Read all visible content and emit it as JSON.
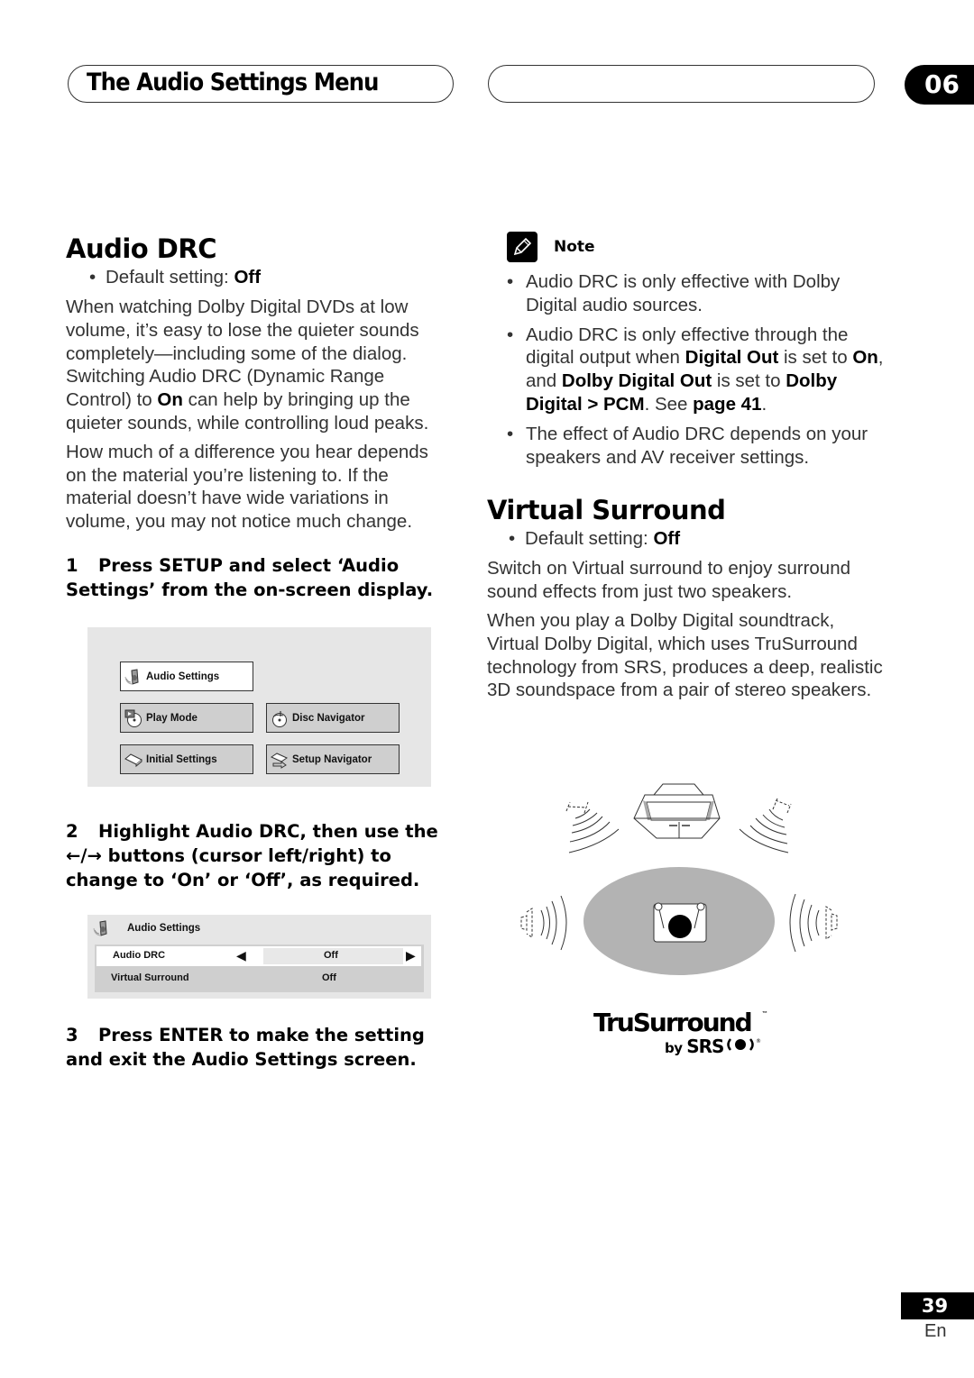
{
  "header": {
    "section_title": "The Audio Settings Menu",
    "middle_pill_text": "",
    "chapter_number": "06"
  },
  "audio_drc": {
    "heading": "Audio DRC",
    "default_label": "Default setting: ",
    "default_value": "Off",
    "para1": {
      "before": "When watching Dolby Digital DVDs at low volume, it’s easy to lose the quieter sounds completely—including some of the dialog. Switching Audio DRC (Dynamic Range Control) to ",
      "bold": "On",
      "after": " can help by bringing up the quieter sounds, while controlling loud peaks."
    },
    "para2": "How much of a difference you hear depends on the material you’re listening to. If the material doesn’t have wide variations in volume, you may not notice much change.",
    "steps": [
      {
        "num": "1",
        "text": "Press SETUP and select ‘Audio Settings’ from the on-screen display."
      },
      {
        "num": "2",
        "arrows": "←/→",
        "text": " buttons (cursor left/right) to change to ‘On’ or ‘Off’, as required.",
        "lead": "Highlight Audio DRC, then use the"
      },
      {
        "num": "3",
        "text": "Press ENTER to make the setting and exit the Audio Settings screen."
      }
    ]
  },
  "setup_menu": {
    "items": [
      {
        "label": "Audio Settings",
        "icon": "speaker-icon",
        "active": true
      },
      {
        "label": "Play Mode",
        "icon": "disc-play-icon",
        "active": false
      },
      {
        "label": "Disc Navigator",
        "icon": "disc-navigator-icon",
        "active": false
      },
      {
        "label": "Initial Settings",
        "icon": "settings-tray-icon",
        "active": false
      },
      {
        "label": "Setup Navigator",
        "icon": "navigator-arrow-icon",
        "active": false
      }
    ]
  },
  "audio_settings_screen": {
    "title": "Audio Settings",
    "rows": [
      {
        "label": "Audio DRC",
        "value": "Off",
        "selected": true,
        "left_arrow": "◀",
        "right_arrow": "▶"
      },
      {
        "label": "Virtual Surround",
        "value": "Off",
        "selected": false
      }
    ]
  },
  "note": {
    "title": "Note",
    "items": [
      {
        "segments": [
          {
            "t": "Audio DRC is only effective with Dolby Digital audio sources.",
            "b": false
          }
        ]
      },
      {
        "segments": [
          {
            "t": "Audio DRC is only effective through the digital output when ",
            "b": false
          },
          {
            "t": "Digital Out",
            "b": true
          },
          {
            "t": " is set to ",
            "b": false
          },
          {
            "t": "On",
            "b": true
          },
          {
            "t": ", and ",
            "b": false
          },
          {
            "t": "Dolby Digital Out",
            "b": true
          },
          {
            "t": " is set to ",
            "b": false
          },
          {
            "t": "Dolby Digital > PCM",
            "b": true
          },
          {
            "t": ". See ",
            "b": false
          },
          {
            "t": "page 41",
            "b": true
          },
          {
            "t": ".",
            "b": false
          }
        ]
      },
      {
        "segments": [
          {
            "t": "The effect of Audio DRC depends on your speakers and AV receiver settings.",
            "b": false
          }
        ]
      }
    ]
  },
  "virtual_surround": {
    "heading": "Virtual Surround",
    "default_label": "Default setting: ",
    "default_value": "Off",
    "para1": "Switch on Virtual surround to enjoy surround sound effects from just two speakers.",
    "para2": "When you play a Dolby Digital soundtrack, Virtual Dolby Digital, which uses TruSurround technology from SRS, produces a deep, realistic 3D soundspace from a pair of stereo speakers."
  },
  "logo": {
    "name": "TruSurround",
    "tm": "™",
    "by": "by",
    "brand": "SRS",
    "reg": "®"
  },
  "footer": {
    "page_number": "39",
    "language": "En"
  }
}
